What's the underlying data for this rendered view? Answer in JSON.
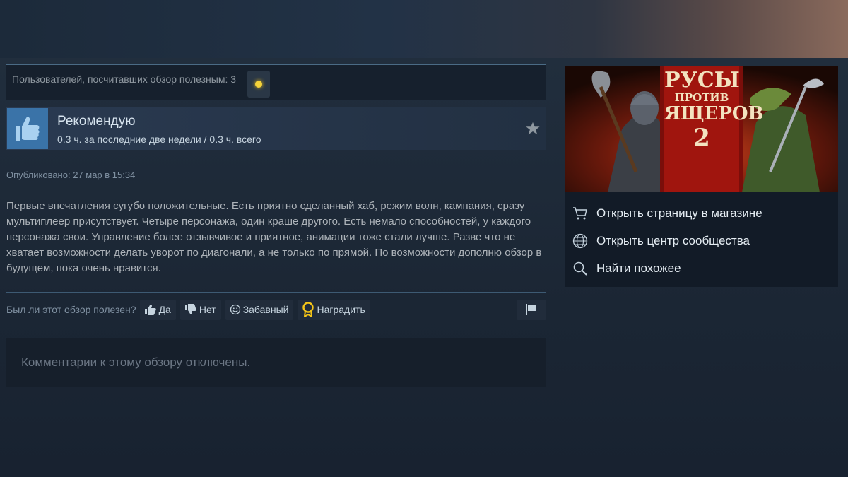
{
  "review": {
    "helpful_text": "Пользователей, посчитавших обзор полезным: 3",
    "recommendation": "Рекомендую",
    "hours": "0.3 ч. за последние две недели / 0.3 ч. всего",
    "posted": "Опубликовано: 27 мар в 15:34",
    "body": "Первые впечатления сугубо положительные. Есть приятно сделанный хаб, режим волн, кампания, сразу мультиплеер присутствует. Четыре персонажа, один краше другого. Есть немало способностей, у каждого персонажа свои. Управление более отзывчивое и приятное, анимации тоже стали лучше. Разве что не хватает возможности делать уворот по диагонали, а не только по прямой. По возможности дополню обзор в будущем, пока очень нравится.",
    "comments_disabled": "Комментарии к этому обзору отключены."
  },
  "vote": {
    "question": "Был ли этот обзор полезен?",
    "yes_label": "Да",
    "no_label": "Нет",
    "funny_label": "Забавный",
    "award_label": "Наградить"
  },
  "game": {
    "capsule_title_line1": "РУСЫ",
    "capsule_title_line2": "ПРОТИВ",
    "capsule_title_line3": "ЯЩЕРОВ",
    "capsule_title_line4": "2"
  },
  "sidebar": {
    "store_link": "Открыть страницу в магазине",
    "community_link": "Открыть центр сообщества",
    "similar_link": "Найти похожее"
  },
  "colors": {
    "background": "#1b2838",
    "thumb_bg": "#3a73a8",
    "accent_gold": "#f5c518"
  },
  "icons": {
    "thumb": "thumbs-up-icon",
    "star": "star-icon",
    "cart": "cart-icon",
    "globe": "globe-icon",
    "search": "search-icon",
    "flag": "flag-icon"
  }
}
